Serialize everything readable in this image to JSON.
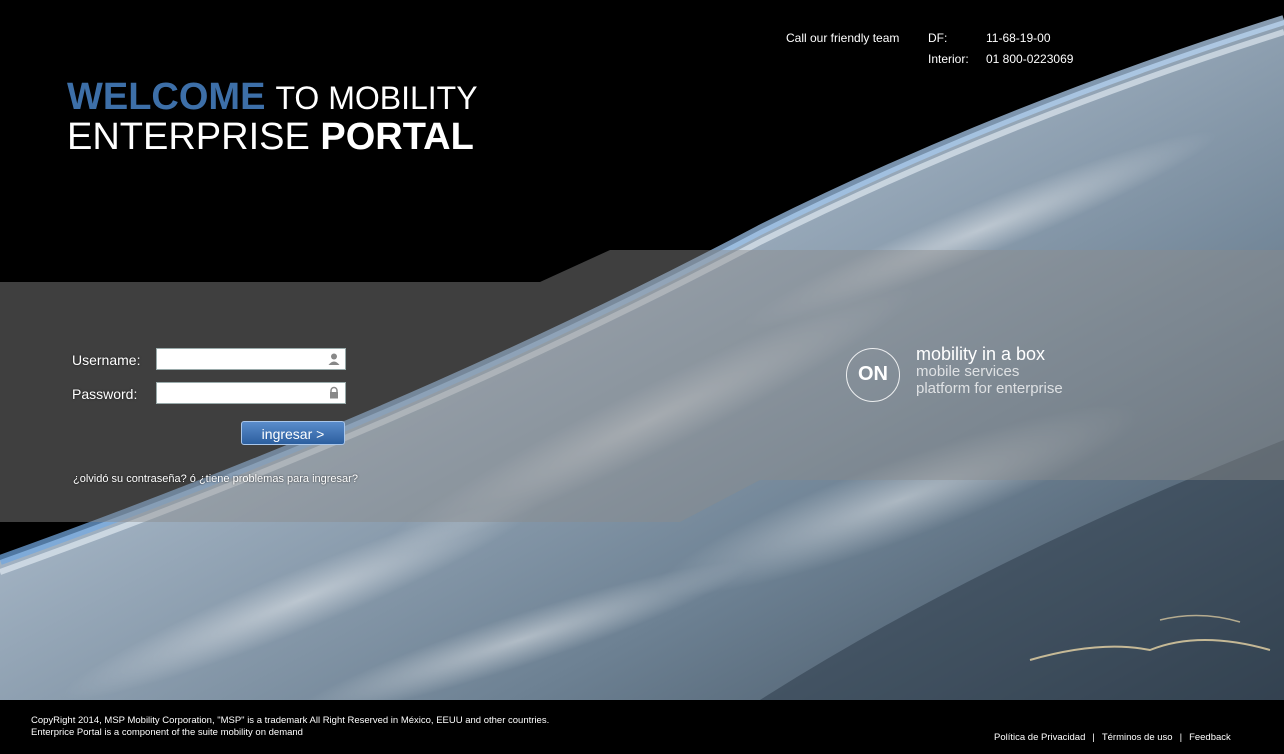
{
  "contact": {
    "intro": "Call our friendly team",
    "rows": [
      {
        "label": "DF:",
        "value": "11-68-19-00"
      },
      {
        "label": "Interior:",
        "value": "01 800-0223069"
      }
    ]
  },
  "title": {
    "welcome": "WELCOME",
    "to_mobility": "TO MOBILITY",
    "enterprise": "ENTERPRISE",
    "portal": "PORTAL"
  },
  "login": {
    "username_label": "Username:",
    "username_value": "",
    "password_label": "Password:",
    "password_value": "",
    "submit_label": "ingresar >",
    "forgot_text": "¿olvidó su contraseña? ó ¿tiene problemas para ingresar?"
  },
  "brand": {
    "logo_text": "ON",
    "tagline1": "mobility in a box",
    "tagline2": "mobile services",
    "tagline3": "platform for enterprise"
  },
  "footer": {
    "copyright": "CopyRight 2014, MSP Mobility Corporation, \"MSP\" is a trademark All Right Reserved in México, EEUU and other countries.",
    "component": "Enterprice Portal is a component of the suite mobility on demand",
    "links": [
      "Política de Privacidad",
      "Términos de uso",
      "Feedback"
    ]
  },
  "icons": {
    "username": "user-icon",
    "password": "lock-icon"
  },
  "colors": {
    "welcome_blue": "#3d6fa8",
    "button_blue": "#2c5f9f"
  }
}
